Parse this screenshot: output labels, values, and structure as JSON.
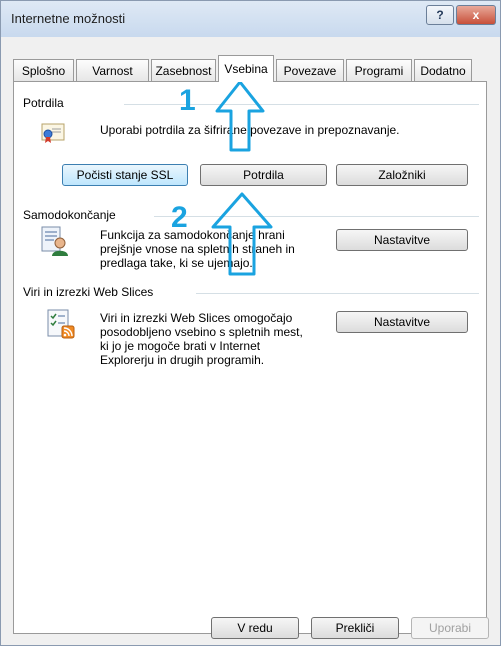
{
  "window": {
    "title": "Internetne možnosti",
    "help_label": "?",
    "close_label": "x"
  },
  "tabs": [
    "Splošno",
    "Varnost",
    "Zasebnost",
    "Vsebina",
    "Povezave",
    "Programi",
    "Dodatno"
  ],
  "certificates": {
    "heading": "Potrdila",
    "description": "Uporabi potrdila za šifrirane povezave in prepoznavanje.",
    "clear_ssl_label": "Počisti stanje SSL",
    "certificates_label": "Potrdila",
    "publishers_label": "Založniki"
  },
  "autocomplete": {
    "heading": "Samodokončanje",
    "desc_line1": "Funkcija za samodokončanje hrani",
    "desc_line2": "prejšnje vnose na spletnih straneh in",
    "desc_line3": "predlaga take, ki se ujemajo.",
    "settings_label": "Nastavitve"
  },
  "feeds": {
    "heading": "Viri in izrezki Web Slices",
    "desc_line1": "Viri in izrezki Web Slices omogočajo",
    "desc_line2": "posodobljeno vsebino s spletnih mest,",
    "desc_line3": "ki jo je mogoče brati v Internet",
    "desc_line4": "Explorerju in drugih programih.",
    "settings_label": "Nastavitve"
  },
  "footer": {
    "ok_label": "V redu",
    "cancel_label": "Prekliči",
    "apply_label": "Uporabi"
  },
  "annotations": {
    "step1": "1",
    "step2": "2",
    "arrow_color": "#1aa3e0"
  },
  "icons": {
    "certificate": "certificate-icon",
    "autocomplete": "autocomplete-icon",
    "feeds": "feeds-icon",
    "arrow": "arrow-up-icon"
  }
}
